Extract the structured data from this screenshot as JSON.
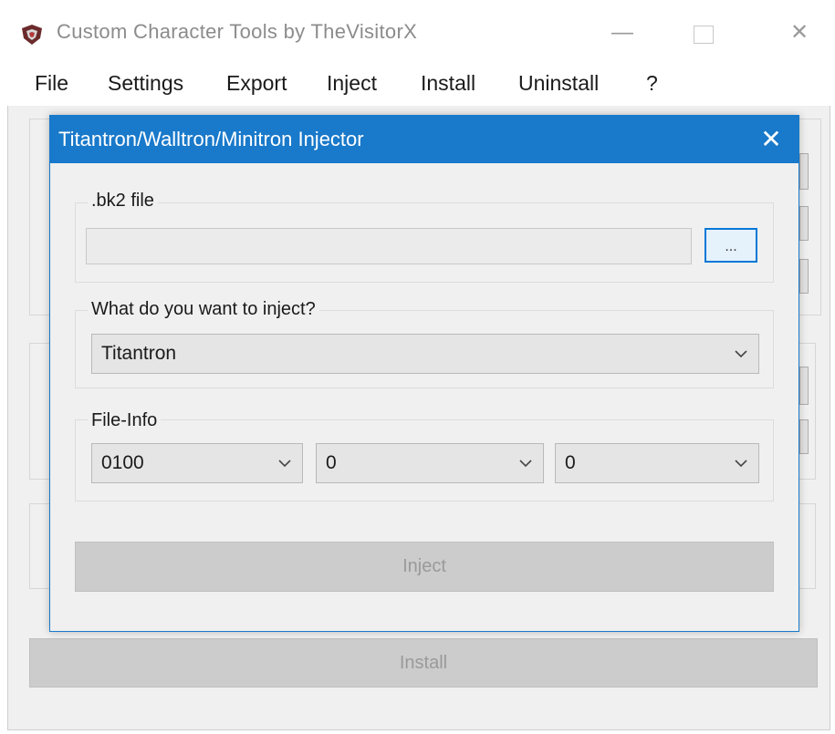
{
  "window": {
    "title": "Custom Character Tools by TheVisitorX",
    "menu": [
      "File",
      "Settings",
      "Export",
      "Inject",
      "Install",
      "Uninstall",
      "?"
    ],
    "install_label": "Install"
  },
  "dialog": {
    "title": "Titantron/Walltron/Minitron Injector",
    "bk2_group": {
      "label": ".bk2 file",
      "path_value": "",
      "browse_label": "..."
    },
    "inject_group": {
      "label": "What do you want to inject?",
      "selected": "Titantron"
    },
    "fileinfo_group": {
      "label": "File-Info",
      "values": [
        "0100",
        "0",
        "0"
      ]
    },
    "inject_label": "Inject"
  },
  "colors": {
    "accent": "#1979ca",
    "focus_border": "#0078d7",
    "window_bg": "#f0f0f0"
  }
}
